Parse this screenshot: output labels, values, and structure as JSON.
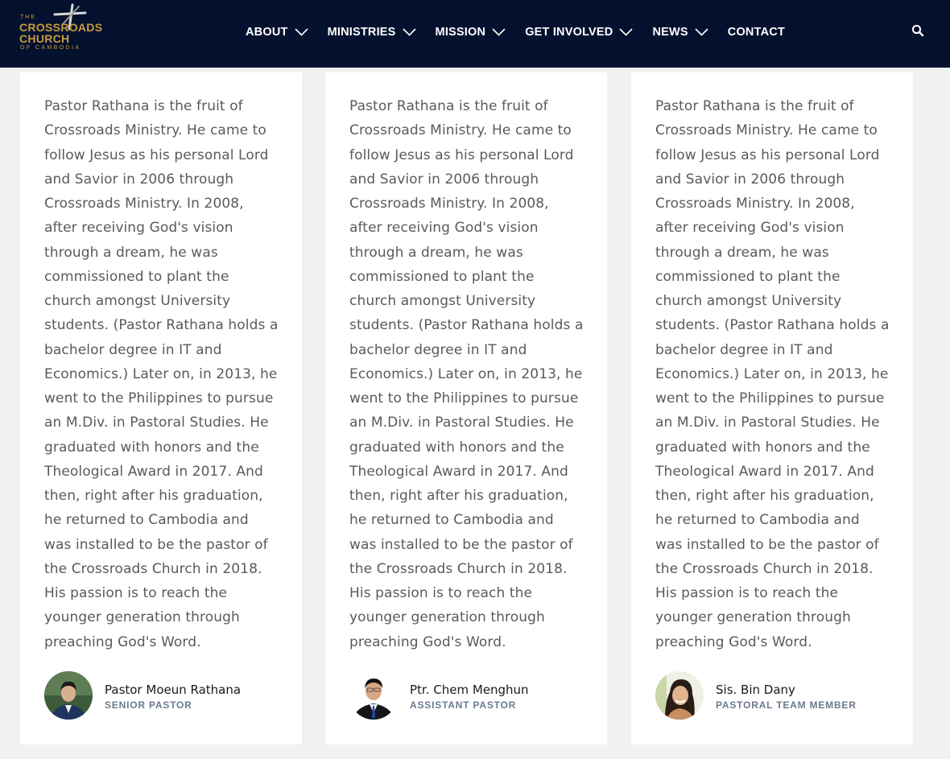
{
  "header": {
    "logo": {
      "small": "THE",
      "line1": "CROSSROADS",
      "line2": "CHURCH",
      "sub": "OF CAMBODIA",
      "color": "#c79a3c"
    },
    "nav": [
      {
        "label": "ABOUT",
        "has_dropdown": true
      },
      {
        "label": "MINISTRIES",
        "has_dropdown": true
      },
      {
        "label": "MISSION",
        "has_dropdown": true
      },
      {
        "label": "GET INVOLVED",
        "has_dropdown": true
      },
      {
        "label": "NEWS",
        "has_dropdown": true
      },
      {
        "label": "CONTACT",
        "has_dropdown": false
      }
    ],
    "search_icon": "search-icon",
    "background": "#04112e"
  },
  "cards": [
    {
      "bio": "Pastor Rathana is the fruit of Crossroads Ministry. He came to follow Jesus as his personal Lord and Savior in 2006 through Crossroads Ministry. In 2008, after receiving God's vision through a dream, he was commissioned to plant the church amongst University students. (Pastor Rathana holds a bachelor degree in IT and Economics.) Later on, in 2013, he went to the Philippines to pursue an M.Div. in Pastoral Studies. He graduated with honors and the Theological Award in 2017. And then, right after his graduation, he returned to Cambodia and was installed to be the pastor of the Crossroads Church in 2018. His passion is to reach the younger generation through preaching God's Word.",
      "name": "Pastor Moeun Rathana",
      "role": "SENIOR PASTOR"
    },
    {
      "bio": "Pastor Rathana is the fruit of Crossroads Ministry. He came to follow Jesus as his personal Lord and Savior in 2006 through Crossroads Ministry. In 2008, after receiving God's vision through a dream, he was commissioned to plant the church amongst University students. (Pastor Rathana holds a bachelor degree in IT and Economics.) Later on, in 2013, he went to the Philippines to pursue an M.Div. in Pastoral Studies. He graduated with honors and the Theological Award in 2017. And then, right after his graduation, he returned to Cambodia and was installed to be the pastor of the Crossroads Church in 2018. His passion is to reach the younger generation through preaching God's Word.",
      "name": "Ptr. Chem Menghun",
      "role": "ASSISTANT PASTOR"
    },
    {
      "bio": "Pastor Rathana is the fruit of Crossroads Ministry. He came to follow Jesus as his personal Lord and Savior in 2006 through Crossroads Ministry. In 2008, after receiving God's vision through a dream, he was commissioned to plant the church amongst University students. (Pastor Rathana holds a bachelor degree in IT and Economics.) Later on, in 2013, he went to the Philippines to pursue an M.Div. in Pastoral Studies. He graduated with honors and the Theological Award in 2017. And then, right after his graduation, he returned to Cambodia and was installed to be the pastor of the Crossroads Church in 2018. His passion is to reach the younger generation through preaching God's Word.",
      "name": "Sis. Bin Dany",
      "role": "PASTORAL TEAM MEMBER"
    }
  ],
  "colors": {
    "page_background": "#f1f1f1",
    "card_background": "#ffffff",
    "bio_text": "#5a5a5a",
    "name_text": "#1a1a1a",
    "role_text": "#6b7a8f"
  }
}
